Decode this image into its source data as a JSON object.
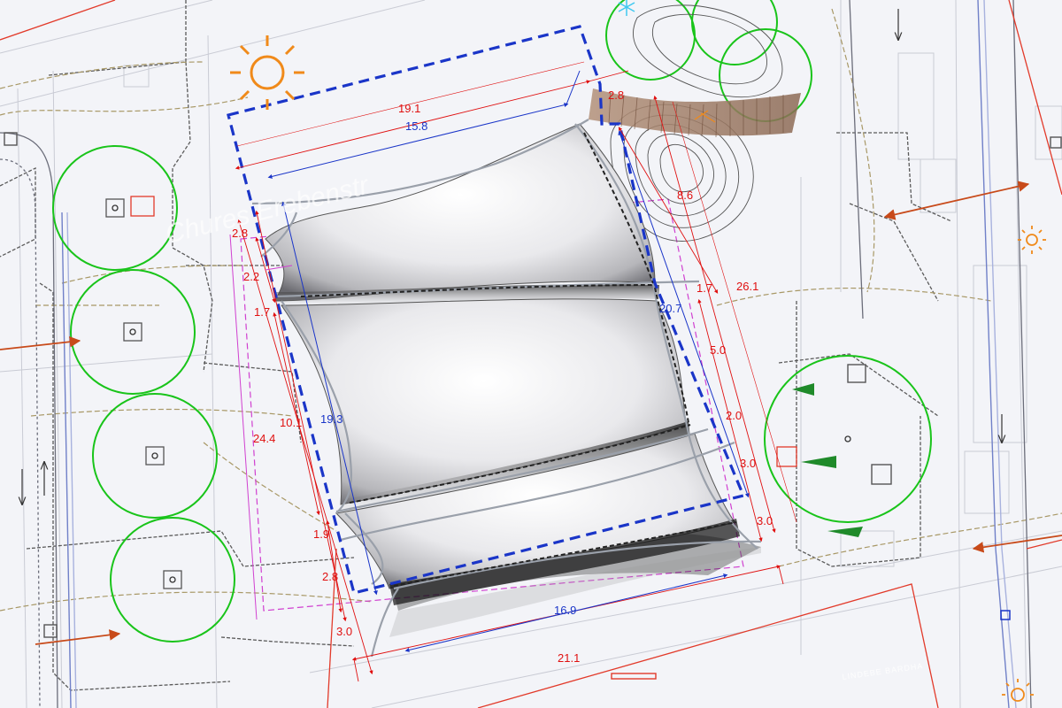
{
  "colors": {
    "background": "#f3f4f8",
    "redline": "#e23a2a",
    "blue_dash": "#1a35c8",
    "tree": "#19c41a",
    "sun": "#f08a1a",
    "arrow": "#c84a1a",
    "magenta": "#d040d0"
  },
  "street_name": "Chures Erebenstr",
  "credit": "LINDEBE BARDHA",
  "dimensions": {
    "d_19_1": "19.1",
    "d_15_8": "15.8",
    "d_2_8_top": "2.8",
    "d_8_6": "8.6",
    "d_2_8_left": "2.8",
    "d_2_2": "2.2",
    "d_1_7_left": "1.7",
    "d_1_7_right": "1.7",
    "d_26_1": "26.1",
    "d_20_7": "20.7",
    "d_5_0": "5.0",
    "d_10_1": "10.1",
    "d_19_3": "19.3",
    "d_24_4": "24.4",
    "d_2_0": "2.0",
    "d_3_0_mid": "3.0",
    "d_3_0_right": "3.0",
    "d_1_9": "1.9",
    "d_2_8_bottom": "2.8",
    "d_16_9": "16.9",
    "d_3_0_bottom": "3.0",
    "d_21_1": "21.1"
  },
  "icons": [
    "sun-icon",
    "flow-arrow-icon",
    "traffic-arrow-icon",
    "tree-icon",
    "snowflake-icon"
  ]
}
